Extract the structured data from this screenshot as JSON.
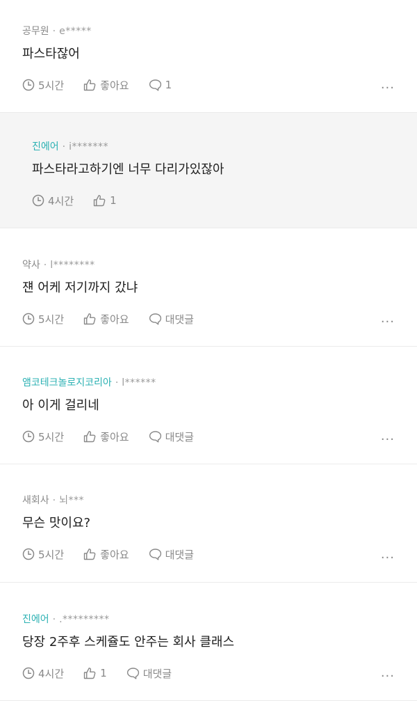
{
  "comments": [
    {
      "author": "공무원",
      "user_id": "e*****",
      "text": "파스타잖어",
      "time": "5시간",
      "like": "좋아요",
      "reply": "1",
      "more": "..."
    },
    {
      "author": "진에어",
      "user_id": "i*******",
      "text": "파스타라고하기엔 너무 다리가있잖아",
      "time": "4시간",
      "like": "1"
    },
    {
      "author": "약사",
      "user_id": "l********",
      "text": "쟨 어케 저기까지 갔냐",
      "time": "5시간",
      "like": "좋아요",
      "reply": "대댓글",
      "more": "..."
    },
    {
      "author": "앰코테크놀로지코리아",
      "user_id": "l******",
      "text": "아 이게 걸리네",
      "time": "5시간",
      "like": "좋아요",
      "reply": "대댓글",
      "more": "..."
    },
    {
      "author": "새회사",
      "user_id": "뇌***",
      "text": "무슨 맛이요?",
      "time": "5시간",
      "like": "좋아요",
      "reply": "대댓글",
      "more": "..."
    },
    {
      "author": "진에어",
      "user_id": ".*********",
      "text": "당장 2주후 스케쥴도 안주는 회사 클래스",
      "time": "4시간",
      "like": "1",
      "reply": "대댓글",
      "more": "..."
    }
  ],
  "separator": "·",
  "colors": {
    "accent_author": "#2bb1b3",
    "meta": "#888888",
    "reply_bg": "#f5f5f5"
  },
  "icons": {
    "time": "clock-icon",
    "like": "thumbs-up-icon",
    "reply": "speech-bubble-icon",
    "more": "more-dots-icon"
  }
}
